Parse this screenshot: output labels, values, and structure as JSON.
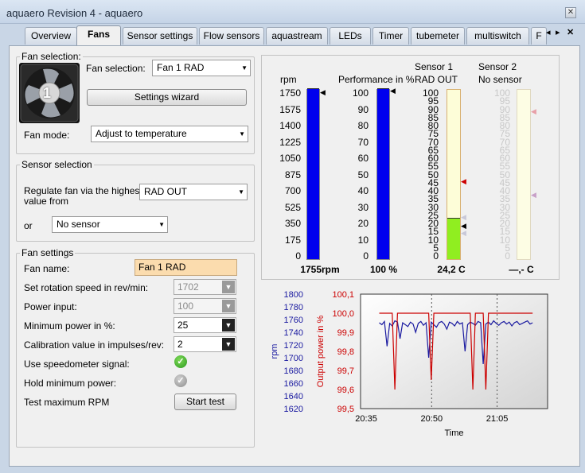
{
  "window": {
    "title": "aquaero Revision 4 -  aquaero",
    "close": "✕"
  },
  "tabs": [
    {
      "label": "Overview",
      "active": false
    },
    {
      "label": "Fans",
      "active": true
    },
    {
      "label": "Sensor settings",
      "active": false
    },
    {
      "label": "Flow sensors",
      "active": false
    },
    {
      "label": "aquastream",
      "active": false
    },
    {
      "label": "LEDs",
      "active": false
    },
    {
      "label": "Timer",
      "active": false
    },
    {
      "label": "tubemeter",
      "active": false
    },
    {
      "label": "multiswitch",
      "active": false
    },
    {
      "label": "F",
      "active": false
    }
  ],
  "tab_nav": {
    "prev": "◂",
    "next": "▸",
    "close": "✕"
  },
  "fan_selection": {
    "legend": "Fan selection:",
    "fan_number": "1",
    "select_label": "Fan selection:",
    "select_value": "Fan 1 RAD",
    "wizard_button": "Settings wizard",
    "mode_label": "Fan mode:",
    "mode_value": "Adjust to temperature"
  },
  "sensor_selection": {
    "legend": "Sensor selection",
    "regulate_label_1": "Regulate fan via the highest",
    "regulate_label_2": "value from",
    "regulate_value": "RAD OUT",
    "or_label": "or",
    "or_value": "No sensor"
  },
  "fan_settings": {
    "legend": "Fan settings",
    "name_label": "Fan name:",
    "name_value": "Fan 1 RAD",
    "rows": [
      {
        "label": "Set rotation speed in rev/min:",
        "value": "1702",
        "disabled": true
      },
      {
        "label": "Power input:",
        "value": "100",
        "disabled": true
      },
      {
        "label": "Minimum power in %:",
        "value": "25",
        "disabled": false
      },
      {
        "label": "Calibration value in impulses/rev:",
        "value": "2",
        "disabled": false
      }
    ],
    "speedometer_label": "Use speedometer signal:",
    "hold_label": "Hold minimum power:",
    "test_label": "Test maximum RPM",
    "test_button": "Start test"
  },
  "gauges": {
    "rpm": {
      "header": "rpm",
      "ticks": [
        "1750",
        "1575",
        "1400",
        "1225",
        "1050",
        "875",
        "700",
        "525",
        "350",
        "175",
        "0"
      ],
      "max": 1750,
      "value": 1755,
      "readout": "1755rpm",
      "color": "#0000ee"
    },
    "perf": {
      "header": "Performance in %",
      "ticks": [
        "100",
        "90",
        "80",
        "70",
        "60",
        "50",
        "40",
        "30",
        "20",
        "10",
        "0"
      ],
      "max": 100,
      "value": 100,
      "readout": "100 %",
      "color": "#0000ee"
    },
    "sensor1": {
      "header1": "Sensor 1",
      "header2": "RAD OUT",
      "ticks": [
        "100",
        "95",
        "90",
        "85",
        "80",
        "75",
        "70",
        "65",
        "60",
        "55",
        "50",
        "45",
        "40",
        "35",
        "30",
        "25",
        "20",
        "15",
        "10",
        "5",
        "0"
      ],
      "max": 100,
      "value": 24.2,
      "readout": "24,2 C",
      "color": "#90ee20"
    },
    "sensor2": {
      "header1": "Sensor 2",
      "header2": "No sensor",
      "ticks": [
        "100",
        "95",
        "90",
        "85",
        "80",
        "75",
        "70",
        "65",
        "60",
        "55",
        "50",
        "45",
        "40",
        "35",
        "30",
        "25",
        "20",
        "15",
        "10",
        "5",
        "0"
      ],
      "readout": "—,- C"
    }
  },
  "chart_data": {
    "type": "line",
    "xlabel": "Time",
    "x_ticks": [
      "20:35",
      "20:50",
      "21:05"
    ],
    "y_left": {
      "label": "rpm",
      "ticks": [
        "1800",
        "1780",
        "1760",
        "1740",
        "1720",
        "1700",
        "1680",
        "1660",
        "1640",
        "1620"
      ],
      "range": [
        1620,
        1800
      ],
      "color": "#1a1aa0"
    },
    "y_right": {
      "label": "Output power in %",
      "ticks": [
        "100,1",
        "100,0",
        "99,9",
        "99,8",
        "99,7",
        "99,6",
        "99,5"
      ],
      "range": [
        99.5,
        100.1
      ],
      "color": "#cc0000"
    },
    "series": [
      {
        "axis": "left",
        "color": "#1a1aa0",
        "values": [
          1755,
          1752,
          1757,
          1718,
          1754,
          1750,
          1758,
          1756,
          1730,
          1755,
          1752,
          1749,
          1756,
          1753,
          1740,
          1754,
          1757,
          1751,
          1755,
          1700,
          1756,
          1752,
          1748,
          1755,
          1757,
          1753,
          1745,
          1756,
          1754,
          1750,
          1757,
          1753,
          1755,
          1710,
          1752,
          1756,
          1754,
          1751,
          1757,
          1755,
          1690,
          1753,
          1756,
          1752,
          1758,
          1754,
          1751,
          1755,
          1757,
          1753,
          1756,
          1750,
          1755,
          1757,
          1752,
          1754,
          1756,
          1758,
          1753,
          1755
        ]
      },
      {
        "axis": "right",
        "color": "#cc0000",
        "values": [
          100,
          100,
          100,
          100,
          100,
          100,
          99.6,
          100,
          100,
          100,
          100,
          100,
          100,
          100,
          100,
          100,
          100,
          100,
          100,
          100,
          99.65,
          100,
          100,
          100,
          100,
          100,
          100,
          100,
          100,
          100,
          100,
          100,
          100,
          100,
          100,
          100,
          99.6,
          100,
          100,
          100,
          100,
          99.6,
          100,
          100,
          100,
          100,
          100,
          100,
          100,
          100,
          100,
          100,
          100,
          100,
          100,
          100,
          100,
          100,
          100,
          100
        ]
      }
    ]
  }
}
